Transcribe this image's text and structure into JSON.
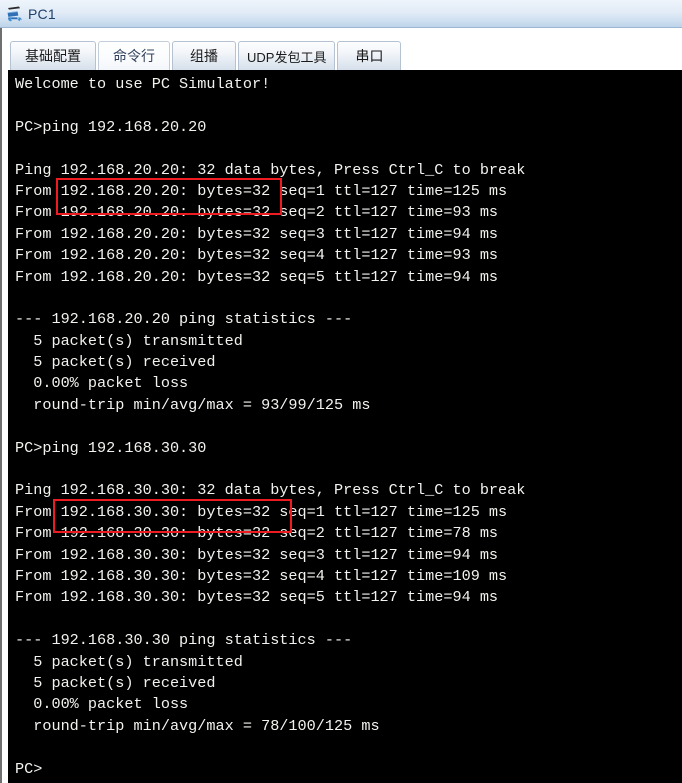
{
  "window": {
    "title": "PC1",
    "icon": "pc-device-icon"
  },
  "tabs": [
    {
      "label": "基础配置",
      "name": "tab-basic-config",
      "active": false
    },
    {
      "label": "命令行",
      "name": "tab-command-line",
      "active": true
    },
    {
      "label": "组播",
      "name": "tab-multicast",
      "active": false
    },
    {
      "label": "UDP发包工具",
      "name": "tab-udp-tool",
      "active": false
    },
    {
      "label": "串口",
      "name": "tab-serial-port",
      "active": false
    }
  ],
  "terminal": {
    "background_color": "#000000",
    "text_color": "#f2f2ee",
    "lines": [
      "Welcome to use PC Simulator!",
      "",
      "PC>ping 192.168.20.20",
      "",
      "Ping 192.168.20.20: 32 data bytes, Press Ctrl_C to break",
      "From 192.168.20.20: bytes=32 seq=1 ttl=127 time=125 ms",
      "From 192.168.20.20: bytes=32 seq=2 ttl=127 time=93 ms",
      "From 192.168.20.20: bytes=32 seq=3 ttl=127 time=94 ms",
      "From 192.168.20.20: bytes=32 seq=4 ttl=127 time=93 ms",
      "From 192.168.20.20: bytes=32 seq=5 ttl=127 time=94 ms",
      "",
      "--- 192.168.20.20 ping statistics ---",
      "  5 packet(s) transmitted",
      "  5 packet(s) received",
      "  0.00% packet loss",
      "  round-trip min/avg/max = 93/99/125 ms",
      "",
      "PC>ping 192.168.30.30",
      "",
      "Ping 192.168.30.30: 32 data bytes, Press Ctrl_C to break",
      "From 192.168.30.30: bytes=32 seq=1 ttl=127 time=125 ms",
      "From 192.168.30.30: bytes=32 seq=2 ttl=127 time=78 ms",
      "From 192.168.30.30: bytes=32 seq=3 ttl=127 time=94 ms",
      "From 192.168.30.30: bytes=32 seq=4 ttl=127 time=109 ms",
      "From 192.168.30.30: bytes=32 seq=5 ttl=127 time=94 ms",
      "",
      "--- 192.168.30.30 ping statistics ---",
      "  5 packet(s) transmitted",
      "  5 packet(s) received",
      "  0.00% packet loss",
      "  round-trip min/avg/max = 78/100/125 ms",
      "",
      "PC>"
    ]
  },
  "annotations": {
    "color": "#ee1c21",
    "boxes": [
      {
        "name": "highlight-box-ping-command-1",
        "target_text": "ping 192.168.20.20"
      },
      {
        "name": "highlight-box-ping-command-2",
        "target_text": "ping 192.168.30.30"
      }
    ]
  }
}
